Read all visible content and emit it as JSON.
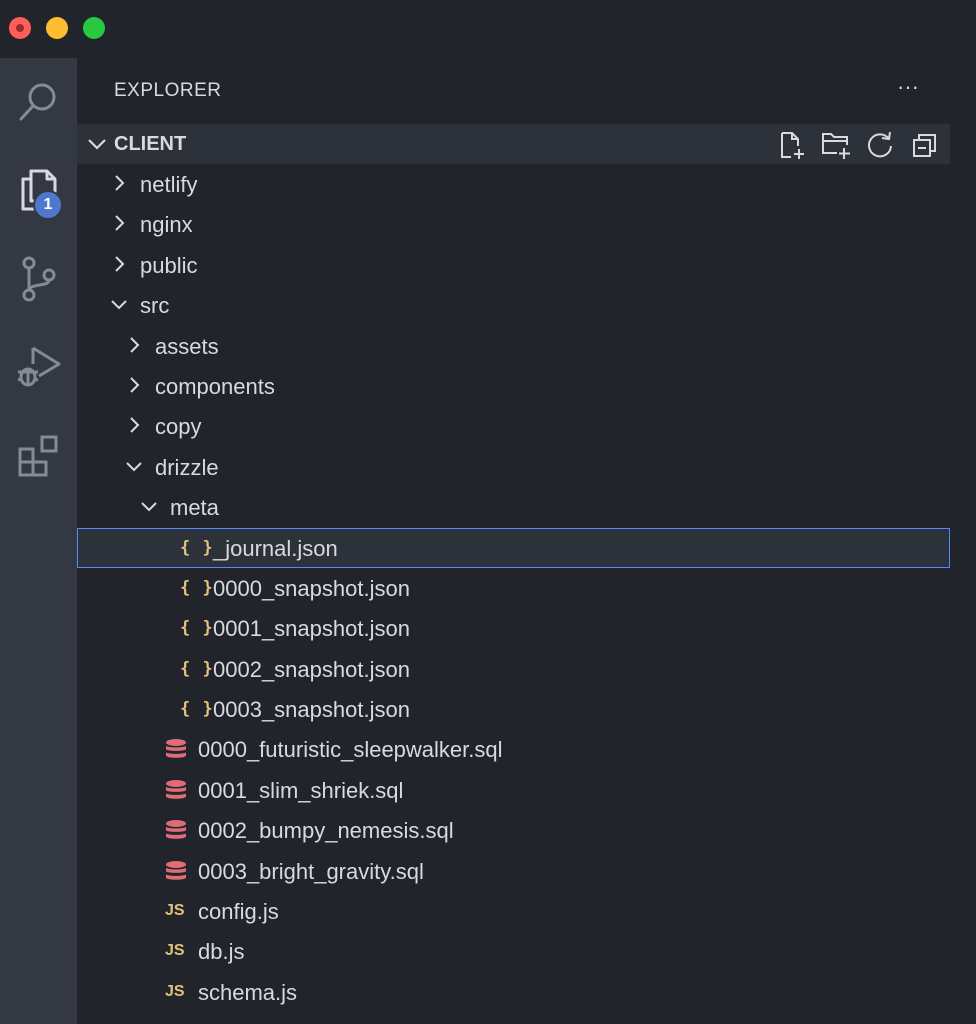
{
  "window": {
    "controls": [
      "close",
      "minimize",
      "maximize"
    ]
  },
  "activity_bar": {
    "items": [
      {
        "icon": "search-icon"
      },
      {
        "icon": "files-icon",
        "badge": "1"
      },
      {
        "icon": "source-control-icon"
      },
      {
        "icon": "run-debug-icon"
      },
      {
        "icon": "extensions-icon"
      }
    ]
  },
  "explorer": {
    "title": "EXPLORER",
    "more_label": "···",
    "section": {
      "title": "CLIENT",
      "tools": [
        "new-file-icon",
        "new-folder-icon",
        "refresh-icon",
        "collapse-all-icon"
      ]
    },
    "tree": [
      {
        "label": "netlify",
        "type": "folder",
        "expanded": false,
        "depth": 0
      },
      {
        "label": "nginx",
        "type": "folder",
        "expanded": false,
        "depth": 0
      },
      {
        "label": "public",
        "type": "folder",
        "expanded": false,
        "depth": 0
      },
      {
        "label": "src",
        "type": "folder",
        "expanded": true,
        "depth": 0
      },
      {
        "label": "assets",
        "type": "folder",
        "expanded": false,
        "depth": 1
      },
      {
        "label": "components",
        "type": "folder",
        "expanded": false,
        "depth": 1
      },
      {
        "label": "copy",
        "type": "folder",
        "expanded": false,
        "depth": 1
      },
      {
        "label": "drizzle",
        "type": "folder",
        "expanded": true,
        "depth": 1
      },
      {
        "label": "meta",
        "type": "folder",
        "expanded": true,
        "depth": 2
      },
      {
        "label": "_journal.json",
        "type": "json",
        "depth": 3,
        "selected": true
      },
      {
        "label": "0000_snapshot.json",
        "type": "json",
        "depth": 3
      },
      {
        "label": "0001_snapshot.json",
        "type": "json",
        "depth": 3
      },
      {
        "label": "0002_snapshot.json",
        "type": "json",
        "depth": 3
      },
      {
        "label": "0003_snapshot.json",
        "type": "json",
        "depth": 3
      },
      {
        "label": "0000_futuristic_sleepwalker.sql",
        "type": "sql",
        "depth": 2
      },
      {
        "label": "0001_slim_shriek.sql",
        "type": "sql",
        "depth": 2
      },
      {
        "label": "0002_bumpy_nemesis.sql",
        "type": "sql",
        "depth": 2
      },
      {
        "label": "0003_bright_gravity.sql",
        "type": "sql",
        "depth": 2
      },
      {
        "label": "config.js",
        "type": "js",
        "depth": 2
      },
      {
        "label": "db.js",
        "type": "js",
        "depth": 2
      },
      {
        "label": "schema.js",
        "type": "js",
        "depth": 2
      }
    ],
    "icon_text": {
      "json": "{}",
      "js": "JS"
    }
  },
  "colors": {
    "accent": "#528bff",
    "badge": "#4d78cc",
    "json_icon": "#e5c07b",
    "sql_icon": "#e06c75",
    "js_icon": "#e5c07b"
  }
}
